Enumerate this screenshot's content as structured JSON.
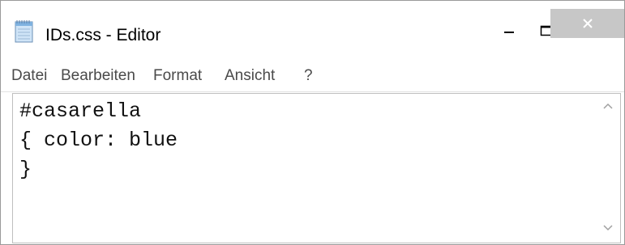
{
  "window": {
    "title": "IDs.css - Editor",
    "app_icon": "notepad-icon"
  },
  "controls": {
    "minimize_icon": "minimize-icon",
    "maximize_icon": "maximize-icon",
    "close_icon": "close-icon"
  },
  "menu": {
    "items": [
      "Datei",
      "Bearbeiten",
      "Format",
      "Ansicht",
      "?"
    ]
  },
  "editor": {
    "lines": [
      "#casarella",
      "{ color: blue",
      "}"
    ],
    "scroll_up_icon": "scroll-up-arrow-icon",
    "scroll_down_icon": "scroll-down-arrow-icon"
  },
  "colors": {
    "close_button_bg": "#c7c7c7",
    "text": "#111111",
    "menu_text": "#4a4a4a"
  }
}
